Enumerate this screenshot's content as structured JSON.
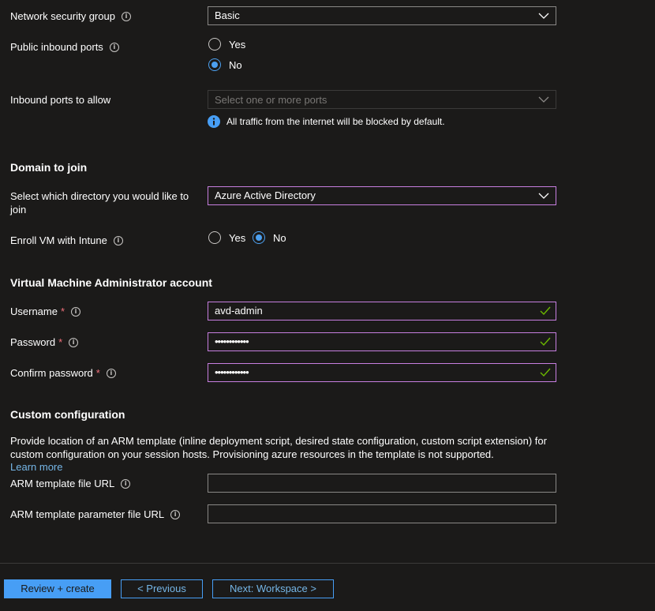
{
  "nsg": {
    "label": "Network security group",
    "value": "Basic"
  },
  "public_ports": {
    "label": "Public inbound ports",
    "options": [
      "Yes",
      "No"
    ],
    "selected": "No"
  },
  "inbound_ports": {
    "label": "Inbound ports to allow",
    "placeholder": "Select one or more ports",
    "info_message": "All traffic from the internet will be blocked by default."
  },
  "domain": {
    "heading": "Domain to join",
    "directory_label_line1": "Select which directory you would like to",
    "directory_label_line2": "join",
    "directory_value": "Azure Active Directory",
    "intune_label": "Enroll VM with Intune",
    "intune_options": [
      "Yes",
      "No"
    ],
    "intune_selected": "No"
  },
  "admin": {
    "heading": "Virtual Machine Administrator account",
    "username_label": "Username",
    "username_value": "avd-admin",
    "password_label": "Password",
    "password_value": "••••••••••••",
    "confirm_label": "Confirm password",
    "confirm_value": "••••••••••••",
    "required_mark": "*"
  },
  "custom": {
    "heading": "Custom configuration",
    "description_line1": "Provide location of an ARM template (inline deployment script, desired state configuration, custom script extension) for",
    "description_line2": "custom configuration on your session hosts. Provisioning azure resources in the template is not supported.",
    "learn_more": "Learn more",
    "template_label": "ARM template file URL",
    "template_value": "",
    "param_label": "ARM template parameter file URL",
    "param_value": ""
  },
  "footer": {
    "review_label": "Review + create",
    "previous_label": "< Previous",
    "next_label": "Next: Workspace >"
  },
  "icons": {
    "info": "info-icon",
    "chevron": "chevron-down-icon",
    "check": "checkmark-icon",
    "info_filled": "info-filled-icon"
  },
  "colors": {
    "background": "#1b1a19",
    "focus_border": "#c77fe0",
    "accent": "#479ef5",
    "check": "#6bb700",
    "required": "#f1707b",
    "link": "#75b6e7"
  }
}
